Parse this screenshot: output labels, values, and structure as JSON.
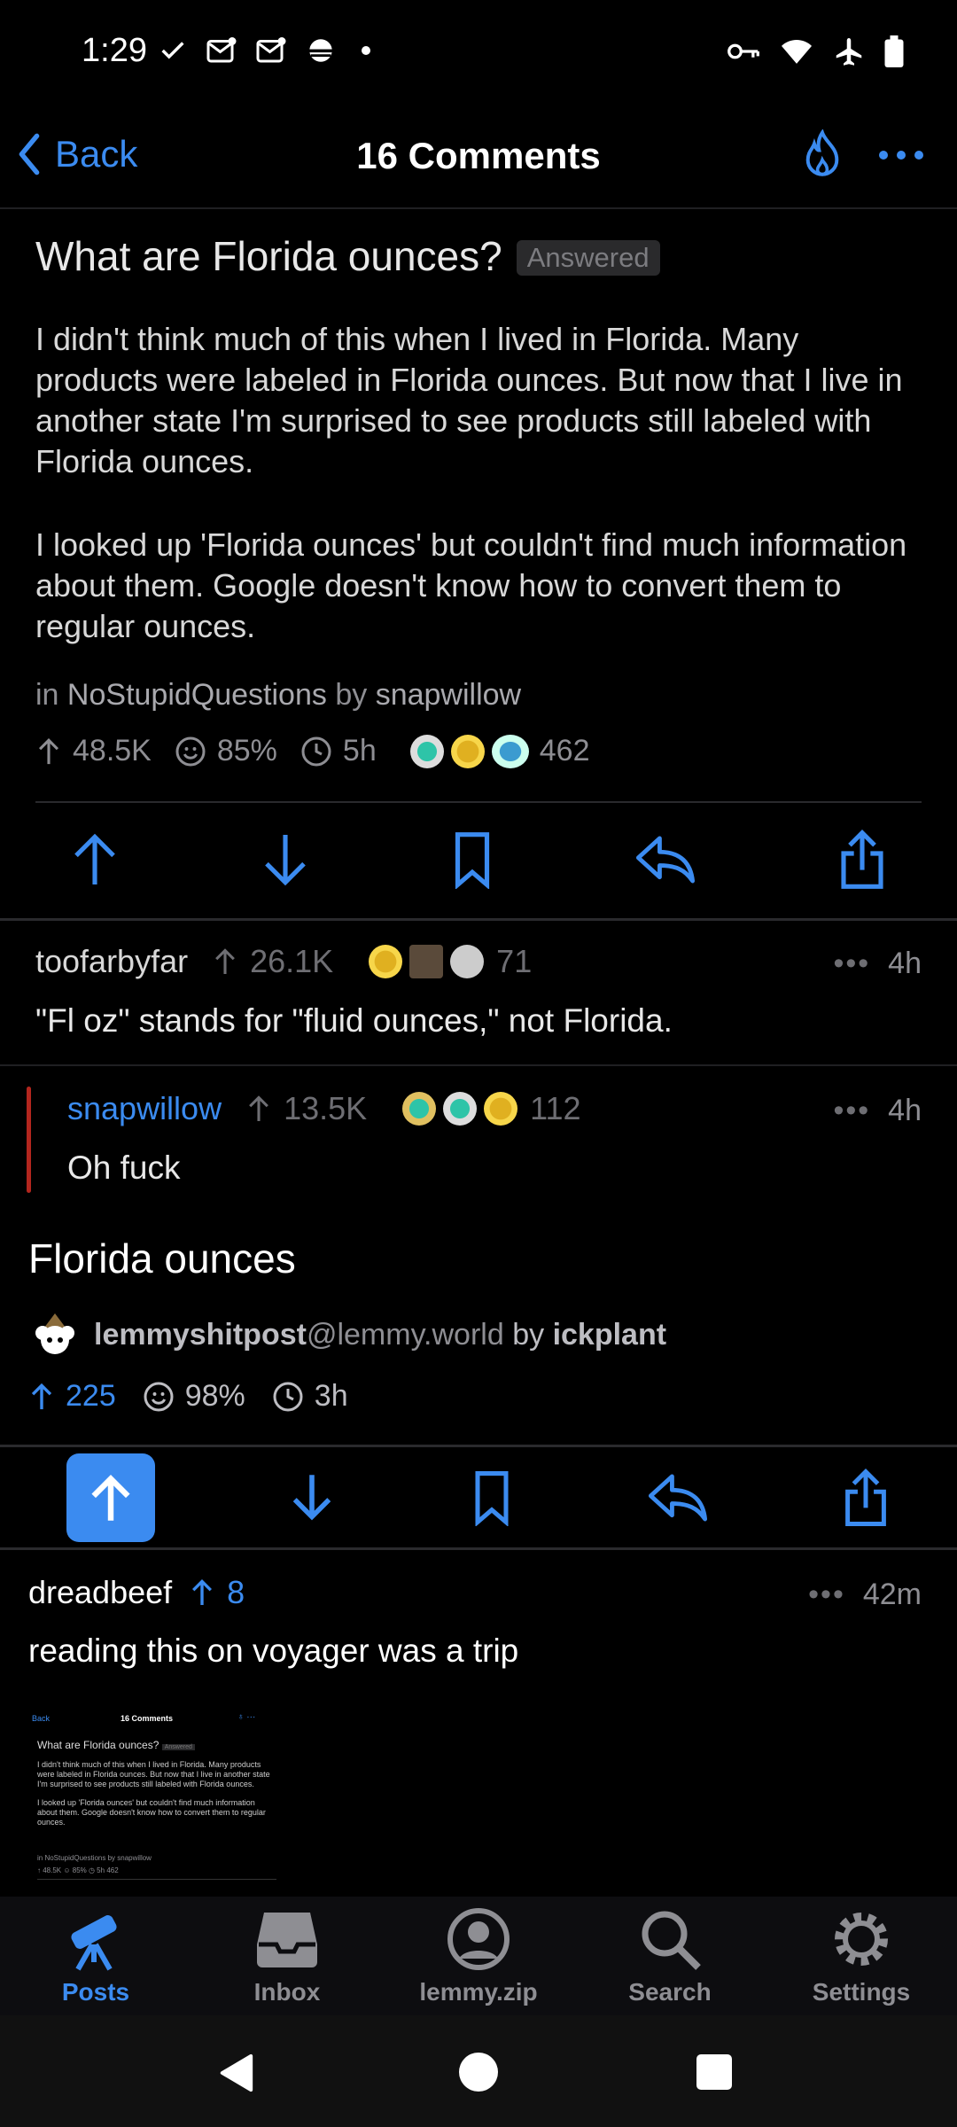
{
  "status_bar": {
    "time": "1:29"
  },
  "nav": {
    "back_label": "Back",
    "title": "16 Comments"
  },
  "post": {
    "title": "What are Florida ounces?",
    "badge": "Answered",
    "paragraphs": [
      "I didn't think much of this when I lived in Florida. Many products were labeled in Florida ounces. But now that I live in another state I'm surprised to see products still labeled with Florida ounces.",
      "I looked up 'Florida ounces' but couldn't find much information about them. Google doesn't know how to convert them to regular ounces."
    ],
    "in_label": "in",
    "community": "NoStupidQuestions",
    "by_label": "by",
    "author": "snapwillow",
    "score": "48.5K",
    "upvote_ratio": "85%",
    "age": "5h",
    "award_count": "462"
  },
  "comments": [
    {
      "author": "toofarbyfar",
      "score": "26.1K",
      "award_count": "71",
      "time": "4h",
      "text": "\"Fl oz\" stands for \"fluid ounces,\" not Florida."
    },
    {
      "author": "snapwillow",
      "score": "13.5K",
      "award_count": "112",
      "time": "4h",
      "text": "Oh fuck"
    }
  ],
  "crosspost": {
    "title": "Florida ounces",
    "community": "lemmyshitpost",
    "instance": "@lemmy.world",
    "by_label": "by",
    "author": "ickplant",
    "score": "225",
    "upvote_ratio": "98%",
    "age": "3h"
  },
  "reply": {
    "author": "dreadbeef",
    "score": "8",
    "time": "42m",
    "text": "reading this on voyager was a trip",
    "thumb": {
      "back": "Back",
      "title": "16 Comments",
      "post_title": "What are Florida ounces?",
      "badge": "Answered",
      "p1": "I didn't think much of this when I lived in Florida. Many products were labeled in Florida ounces. But now that I live in another state I'm surprised to see products still labeled with Florida ounces.",
      "p2": "I looked up 'Florida ounces' but couldn't find much information about them. Google doesn't know how to convert them to regular ounces.",
      "meta": "in NoStupidQuestions by snapwillow",
      "stats": "↑ 48.5K ☺ 85% ◷ 5h",
      "award_count": "462"
    }
  },
  "tabs": [
    {
      "label": "Posts",
      "icon": "telescope-icon"
    },
    {
      "label": "Inbox",
      "icon": "inbox-icon"
    },
    {
      "label": "lemmy.zip",
      "icon": "profile-icon"
    },
    {
      "label": "Search",
      "icon": "search-icon"
    },
    {
      "label": "Settings",
      "icon": "gear-icon"
    }
  ],
  "colors": {
    "accent": "#3b8bf0",
    "background": "#000000",
    "muted": "#8e8e93",
    "thread_line": "#b3261e"
  }
}
